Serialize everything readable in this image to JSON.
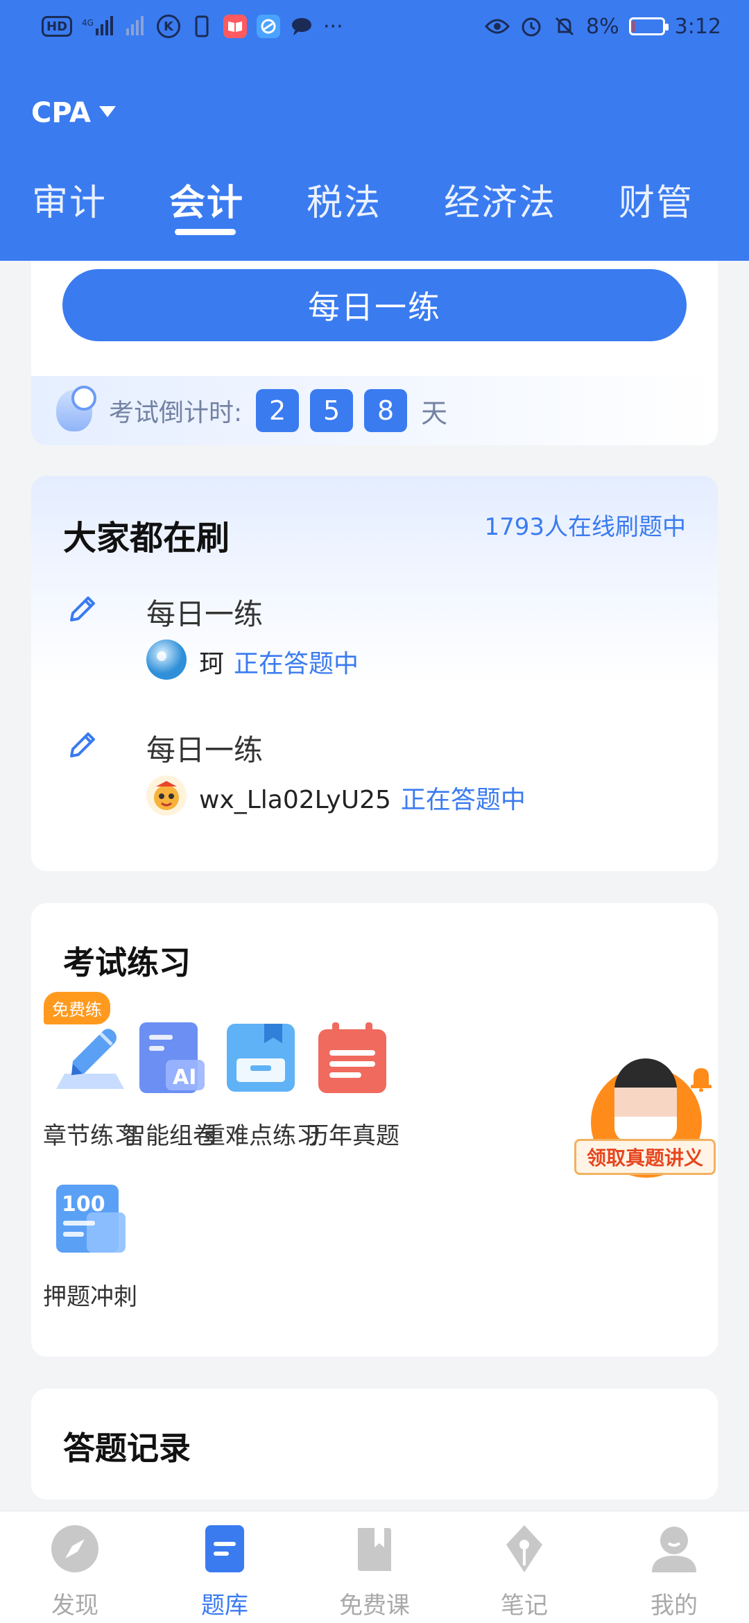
{
  "status_bar": {
    "left_icons": [
      "hd-icon",
      "signal-4g-icon",
      "signal-2-icon",
      "k-app-icon",
      "phone-icon",
      "book-app-icon",
      "browser-app-icon",
      "message-app-icon",
      "more-icon"
    ],
    "more": "···",
    "battery": "8%",
    "time": "3:12",
    "battery_color": "#e53935"
  },
  "header": {
    "exam_selector": "CPA",
    "tabs": [
      {
        "label": "审计",
        "active": false
      },
      {
        "label": "会计",
        "active": true
      },
      {
        "label": "税法",
        "active": false
      },
      {
        "label": "经济法",
        "active": false
      },
      {
        "label": "财管",
        "active": false
      }
    ],
    "accent_color": "#3a7bf0"
  },
  "daily": {
    "button_label": "每日一练"
  },
  "countdown": {
    "label": "考试倒计时:",
    "digits": [
      "2",
      "5",
      "8"
    ],
    "unit": "天"
  },
  "hot": {
    "title": "大家都在刷",
    "online": "1793人在线刷题中",
    "entries": [
      {
        "title": "每日一练",
        "user": "珂",
        "status": "正在答题中"
      },
      {
        "title": "每日一练",
        "user": "wx_Lla02LyU25",
        "status": "正在答题中"
      }
    ]
  },
  "practice": {
    "title": "考试练习",
    "free_badge": "免费练",
    "items": [
      {
        "label": "章节练习",
        "icon": "pencil-icon"
      },
      {
        "label": "智能组卷",
        "icon": "ai-paper-icon"
      },
      {
        "label": "重难点练习",
        "icon": "inbox-icon"
      },
      {
        "label": "历年真题",
        "icon": "calendar-icon"
      },
      {
        "label": "押题冲刺",
        "icon": "score-100-icon"
      }
    ]
  },
  "promo": {
    "label": "领取真题讲义"
  },
  "records": {
    "title": "答题记录"
  },
  "bottom_nav": [
    {
      "label": "发现",
      "icon": "compass-icon",
      "active": false
    },
    {
      "label": "题库",
      "icon": "question-bank-icon",
      "active": true
    },
    {
      "label": "免费课",
      "icon": "book-icon",
      "active": false
    },
    {
      "label": "笔记",
      "icon": "pen-nib-icon",
      "active": false
    },
    {
      "label": "我的",
      "icon": "profile-icon",
      "active": false
    }
  ]
}
